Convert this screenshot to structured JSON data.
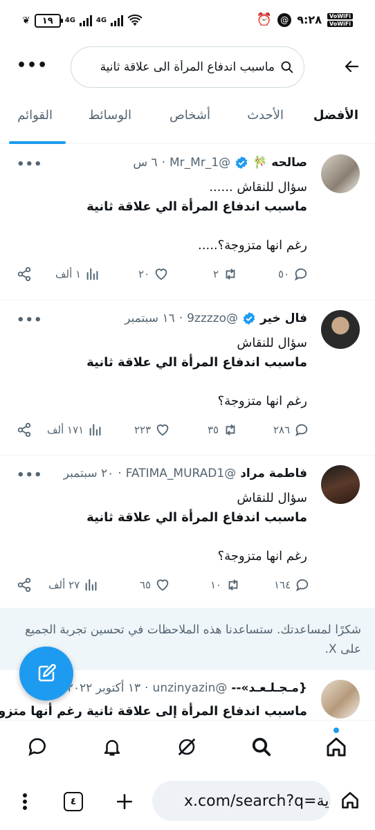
{
  "status_bar": {
    "time": "٩:٢٨",
    "battery": "١٩",
    "network_1": "4G",
    "network_2": "4G",
    "wifi_label_1": "VoWiFi",
    "wifi_label_2": "VoWiFi"
  },
  "search": {
    "query": "ماسبب اندفاع المرأة الى علاقة ثانية"
  },
  "tabs": [
    "الأفضل",
    "الأحدث",
    "أشخاص",
    "الوسائط",
    "القوائم"
  ],
  "tweets": [
    {
      "name": "صالحه 🎋",
      "handle": "@Mr_Mr_1",
      "dot": "·",
      "time": "٦ س",
      "verified": true,
      "lines": [
        "سؤال للنقاش ......",
        "ماسبب اندفاع المرأة الي علاقة ثانية",
        "",
        "رغم انها متزوجة؟.....",
        ""
      ],
      "bold_lines": [
        1
      ],
      "replies": "٥٠",
      "retweets": "٢",
      "likes": "٢٠",
      "views": "١ ألف"
    },
    {
      "name": "فال خير",
      "handle": "@9zzzzo",
      "dot": "·",
      "time": "١٦ سبتمبر",
      "verified": true,
      "lines": [
        "سؤال للنقاش",
        "ماسبب اندفاع المرأة الي علاقة ثانية",
        "",
        "رغم انها متزوجة؟"
      ],
      "bold_lines": [
        1
      ],
      "replies": "٢٨٦",
      "retweets": "٣٥",
      "likes": "٢٢٣",
      "views": "١٧١ ألف"
    },
    {
      "name": "فاطمة مراد",
      "handle": "@FATIMA_MURAD1",
      "dot": "·",
      "time": "٢٠ سبتمبر",
      "verified": false,
      "lines": [
        "سؤال للنقاش",
        "ماسبب اندفاع المرأة الي علاقة ثانية",
        "",
        "رغم انها متزوجة؟"
      ],
      "bold_lines": [
        1
      ],
      "replies": "١٦٤",
      "retweets": "١٠",
      "likes": "٦٥",
      "views": "٢٧ ألف"
    },
    {
      "name": "{مـجـلـعـد»--",
      "handle": "@unzinyazin",
      "dot": "·",
      "time": "١٣ أكتوبر ٢٠٢٢",
      "verified": false,
      "lines": [
        "ماسبب اندفاع المرأة إلى علاقة ثانية رغم أنها متزوجة"
      ],
      "bold_lines": []
    }
  ],
  "notice": {
    "text": "شكرًا لمساعدتك. ستساعدنا هذه الملاحظات في تحسين تجربة الجميع على X."
  },
  "bottom_nav": [
    "home-icon",
    "search-icon",
    "grok-icon",
    "notifications-icon",
    "messages-icon"
  ],
  "browser": {
    "url": "x.com/search?q=ية",
    "tab_count": "٤"
  },
  "colors": {
    "accent": "#1d9bf0",
    "text": "#0f1419",
    "secondary": "#536471"
  }
}
